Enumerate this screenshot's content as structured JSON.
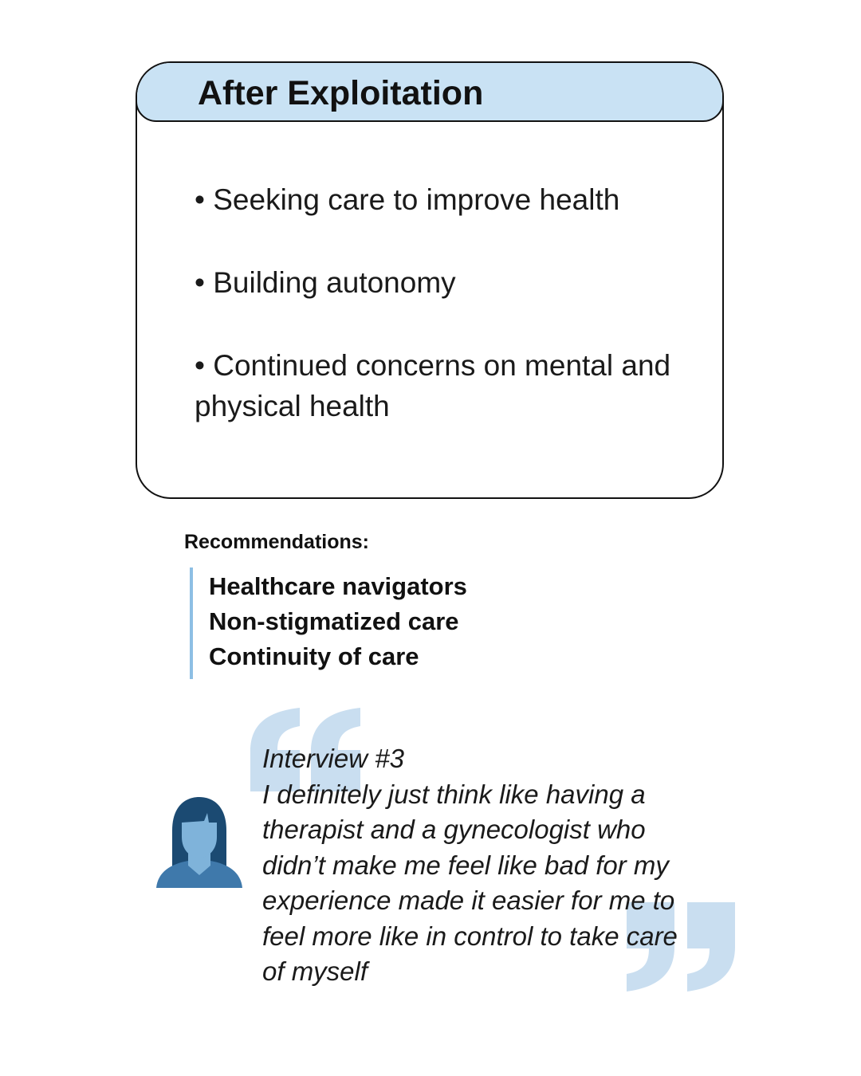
{
  "card": {
    "title": "After Exploitation",
    "bullets": [
      "• Seeking care to improve health",
      "• Building autonomy",
      "• Continued concerns on mental and physical health"
    ]
  },
  "recommendations": {
    "heading": "Recommendations:",
    "items": [
      "Healthcare navigators",
      "Non-stigmatized care",
      "Continuity of care"
    ]
  },
  "quote": {
    "source": "Interview #3",
    "lines": [
      "I definitely just think like having a",
      "therapist and a gynecologist who",
      "didn’t make me feel like bad for my",
      "experience made it easier for me to",
      "feel more like in control to take care",
      "of myself"
    ]
  },
  "icons": {
    "avatar": "woman-avatar-icon",
    "open_quote": "open-quote-icon",
    "close_quote": "close-quote-icon"
  },
  "colors": {
    "header_fill": "#c9e2f4",
    "quote_mark": "#c9def0",
    "accent_bar": "#8dbfe4",
    "avatar_hair": "#1b4a72",
    "avatar_face": "#7fb3da",
    "avatar_body": "#3f79ab"
  }
}
